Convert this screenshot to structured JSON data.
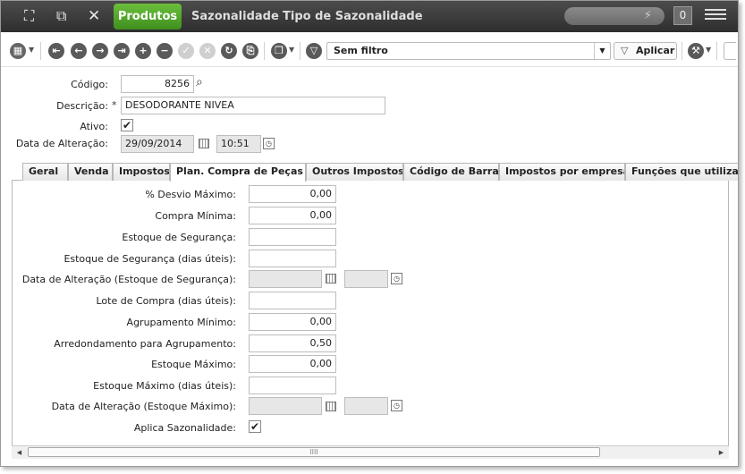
{
  "header": {
    "tabs": [
      {
        "label": "Produtos",
        "active": true
      },
      {
        "label": "Sazonalidade",
        "active": false
      },
      {
        "label": "Tipo de Sazonalidade",
        "active": false
      }
    ],
    "search_icon": "lightning-icon",
    "count": "0"
  },
  "toolbar": {
    "filter_value": "Sem filtro",
    "apply_label": "Aplicar"
  },
  "form": {
    "codigo_label": "Código:",
    "codigo_value": "8256",
    "descricao_label": "Descrição:",
    "descricao_value": "DESODORANTE NIVEA",
    "required_mark": "*",
    "ativo_label": "Ativo:",
    "ativo_checked": true,
    "data_alteracao_label": "Data de Alteração:",
    "data_alteracao_date": "29/09/2014",
    "data_alteracao_time": "10:51"
  },
  "tabs": [
    {
      "label": "Geral"
    },
    {
      "label": "Venda"
    },
    {
      "label": "Impostos"
    },
    {
      "label": "Plan. Compra de Peças",
      "active": true
    },
    {
      "label": "Outros Impostos"
    },
    {
      "label": "Código de Barras"
    },
    {
      "label": "Impostos por empresa"
    },
    {
      "label": "Funções que utilizam P"
    }
  ],
  "plan": {
    "desvio_label": "% Desvio Máximo:",
    "desvio_value": "0,00",
    "compra_min_label": "Compra Mínima:",
    "compra_min_value": "0,00",
    "estoque_seg_label": "Estoque de Segurança:",
    "estoque_seg_value": "",
    "estoque_seg_dias_label": "Estoque de Segurança (dias úteis):",
    "estoque_seg_dias_value": "",
    "data_alt_seg_label": "Data de Alteração (Estoque de Segurança):",
    "lote_label": "Lote de Compra (dias úteis):",
    "lote_value": "",
    "agrup_label": "Agrupamento Mínimo:",
    "agrup_value": "0,00",
    "arred_label": "Arredondamento para Agrupamento:",
    "arred_value": "0,50",
    "est_max_label": "Estoque Máximo:",
    "est_max_value": "0,00",
    "est_max_dias_label": "Estoque Máximo (dias úteis):",
    "est_max_dias_value": "",
    "data_alt_max_label": "Data de Alteração (Estoque Máximo):",
    "sazonal_label": "Aplica Sazonalidade:",
    "sazonal_checked": true
  },
  "scrollbar": {
    "grip": "IIII"
  }
}
